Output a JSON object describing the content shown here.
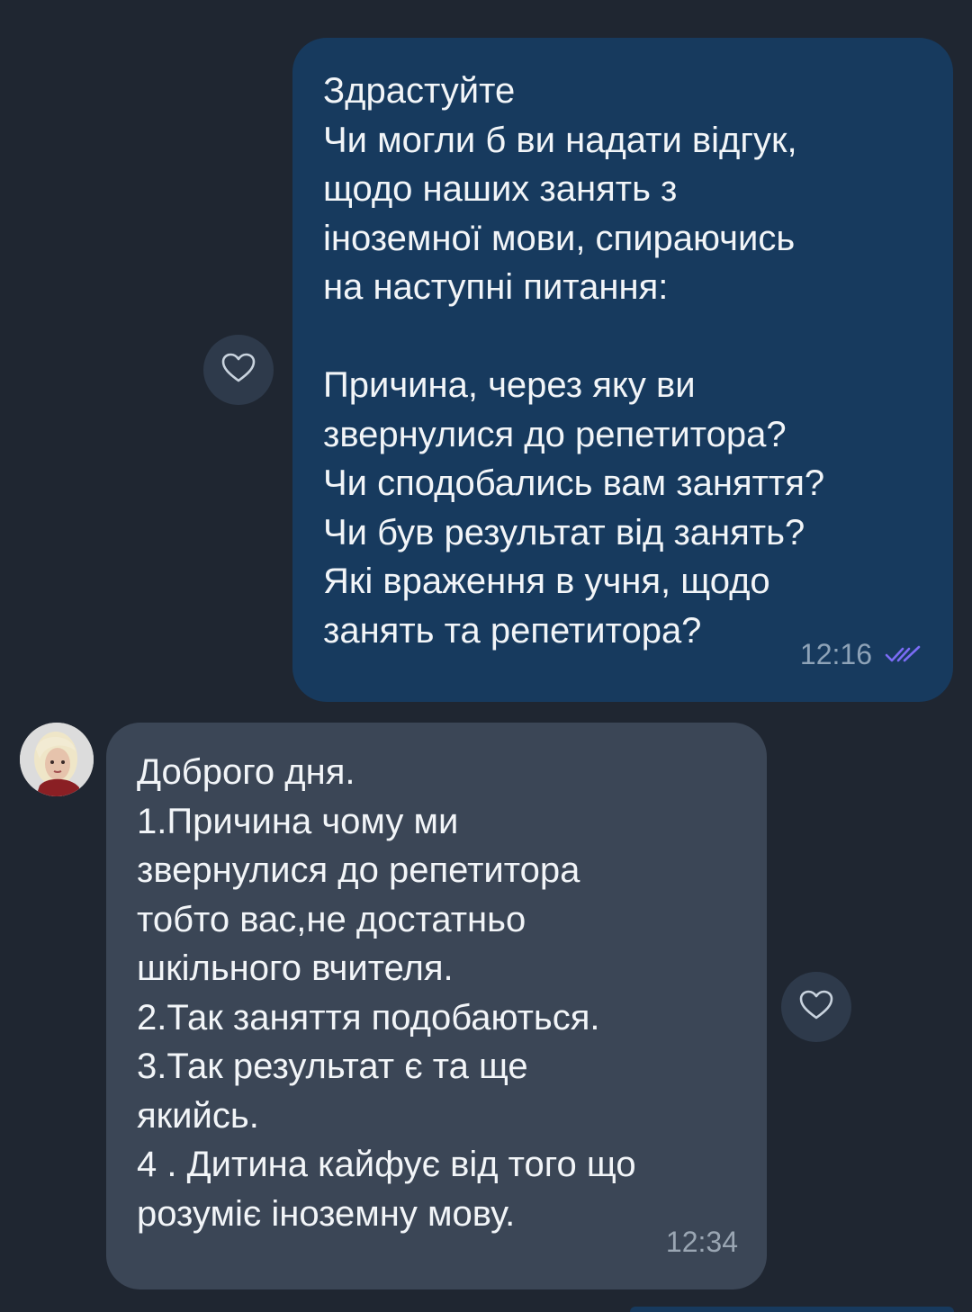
{
  "colors": {
    "background": "#1f2631",
    "outgoing_bubble": "#173a5e",
    "incoming_bubble": "#3b4656",
    "text": "#f2f5f8",
    "read_check": "#7b6cf6"
  },
  "messages": [
    {
      "direction": "outgoing",
      "lines": [
        "Здрастуйте",
        "Чи могли б ви надати відгук,",
        "щодо наших занять з",
        "іноземної мови, спираючись",
        "на наступні питання:",
        "",
        "Причина, через яку ви",
        "звернулися до репетитора?",
        "Чи сподобались вам заняття?",
        "Чи був результат від занять?",
        "Які враження в учня, щодо",
        "занять та репетитора?"
      ],
      "time": "12:16",
      "status_icon": "double-check-icon",
      "reaction_icon": "heart-outline-icon"
    },
    {
      "direction": "incoming",
      "lines": [
        "Доброго дня.",
        "1.Причина чому ми",
        "звернулися до репетитора",
        "тобто вас,не достатньо",
        "шкільного вчителя.",
        "2.Так заняття подобаються.",
        "3.Так результат є та ще",
        "якийсь.",
        "4 . Дитина кайфує від того що",
        "розуміє іноземну мову."
      ],
      "time": "12:34",
      "avatar_icon": "user-avatar",
      "reaction_icon": "heart-outline-icon"
    }
  ]
}
